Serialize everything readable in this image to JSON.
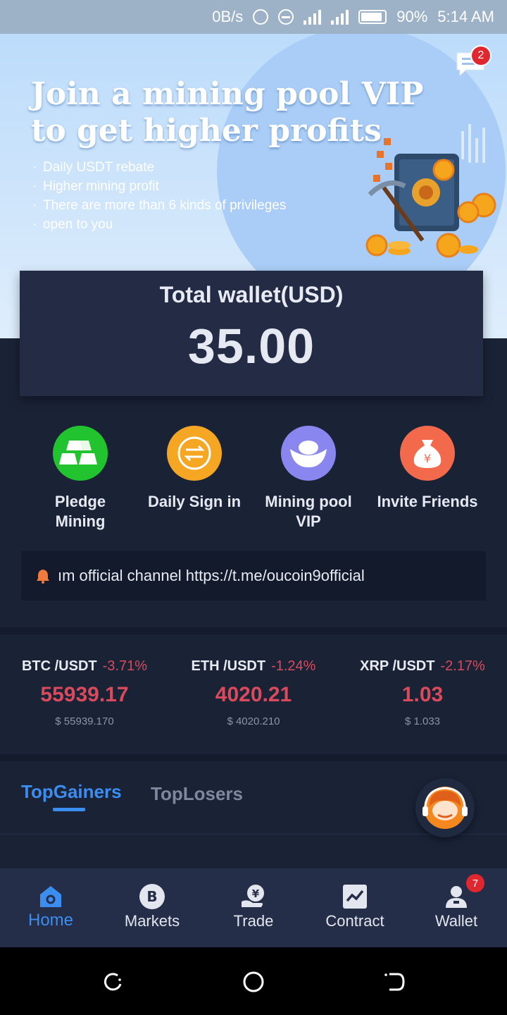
{
  "status_bar": {
    "net_speed": "0B/s",
    "network_type": "3G",
    "battery": "90%",
    "time": "5:14 AM"
  },
  "banner": {
    "title_line1": "Join a mining pool VIP",
    "title_line2": "to get higher profits",
    "bullets": [
      "Daily USDT rebate",
      "Higher mining profit",
      "There are more than 6 kinds of privileges",
      " open to you"
    ],
    "message_badge": "2"
  },
  "wallet": {
    "title": "Total wallet(USD)",
    "value": "35.00"
  },
  "quick_actions": [
    {
      "label_line1": "Pledge",
      "label_line2": "Mining",
      "icon": "gold-bars-icon",
      "color": "#21c32e"
    },
    {
      "label_line1": "Daily Sign in",
      "label_line2": "",
      "icon": "exchange-arrows-icon",
      "color": "#f5a623"
    },
    {
      "label_line1": "Mining pool",
      "label_line2": "VIP",
      "icon": "gold-ingot-icon",
      "color": "#8a86f0"
    },
    {
      "label_line1": "Invite Friends",
      "label_line2": "",
      "icon": "money-bag-icon",
      "color": "#f26a4b"
    }
  ],
  "notice": {
    "text": "ım official channel  https://t.me/oucoin9official"
  },
  "tickers": [
    {
      "pair": "BTC /USDT",
      "change": "-3.71%",
      "price": "55939.17",
      "usd": "$ 55939.170"
    },
    {
      "pair": "ETH /USDT",
      "change": "-1.24%",
      "price": "4020.21",
      "usd": "$ 4020.210"
    },
    {
      "pair": "XRP /USDT",
      "change": "-2.17%",
      "price": "1.03",
      "usd": "$ 1.033"
    }
  ],
  "tabs": {
    "active": "TopGainers",
    "inactive": "TopLosers"
  },
  "bottom_nav": {
    "items": [
      {
        "label": "Home",
        "icon": "home-icon"
      },
      {
        "label": "Markets",
        "icon": "bitcoin-icon"
      },
      {
        "label": "Trade",
        "icon": "trade-icon"
      },
      {
        "label": "Contract",
        "icon": "chart-icon"
      },
      {
        "label": "Wallet",
        "icon": "user-icon"
      }
    ],
    "wallet_badge": "7"
  },
  "colors": {
    "accent": "#3b8df0",
    "negative": "#d94a5c",
    "background": "#1a2236"
  }
}
